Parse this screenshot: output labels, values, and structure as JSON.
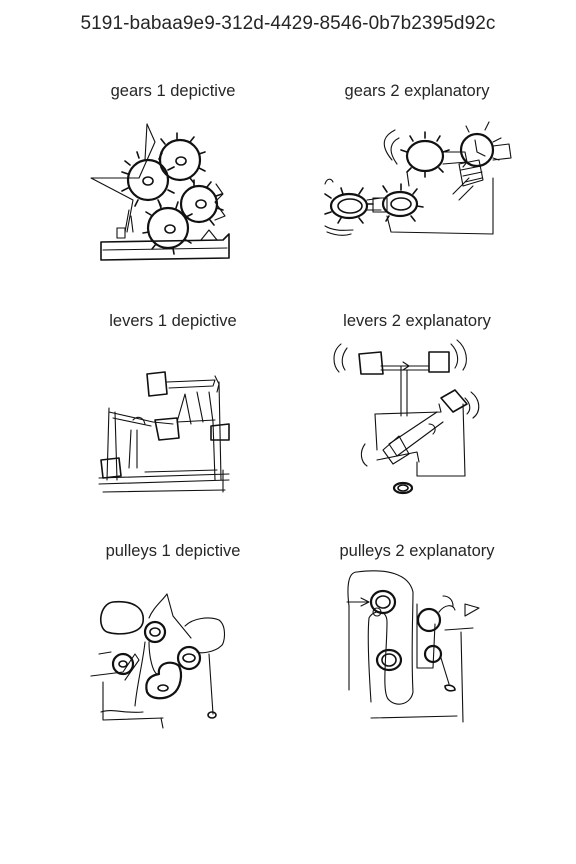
{
  "title": "5191-babaa9e9-312d-4429-8546-0b7b2395d92c",
  "panels": [
    {
      "title": "gears 1 depictive"
    },
    {
      "title": "gears 2 explanatory"
    },
    {
      "title": "levers 1 depictive"
    },
    {
      "title": "levers 2 explanatory"
    },
    {
      "title": "pulleys 1 depictive"
    },
    {
      "title": "pulleys 2 explanatory"
    }
  ]
}
